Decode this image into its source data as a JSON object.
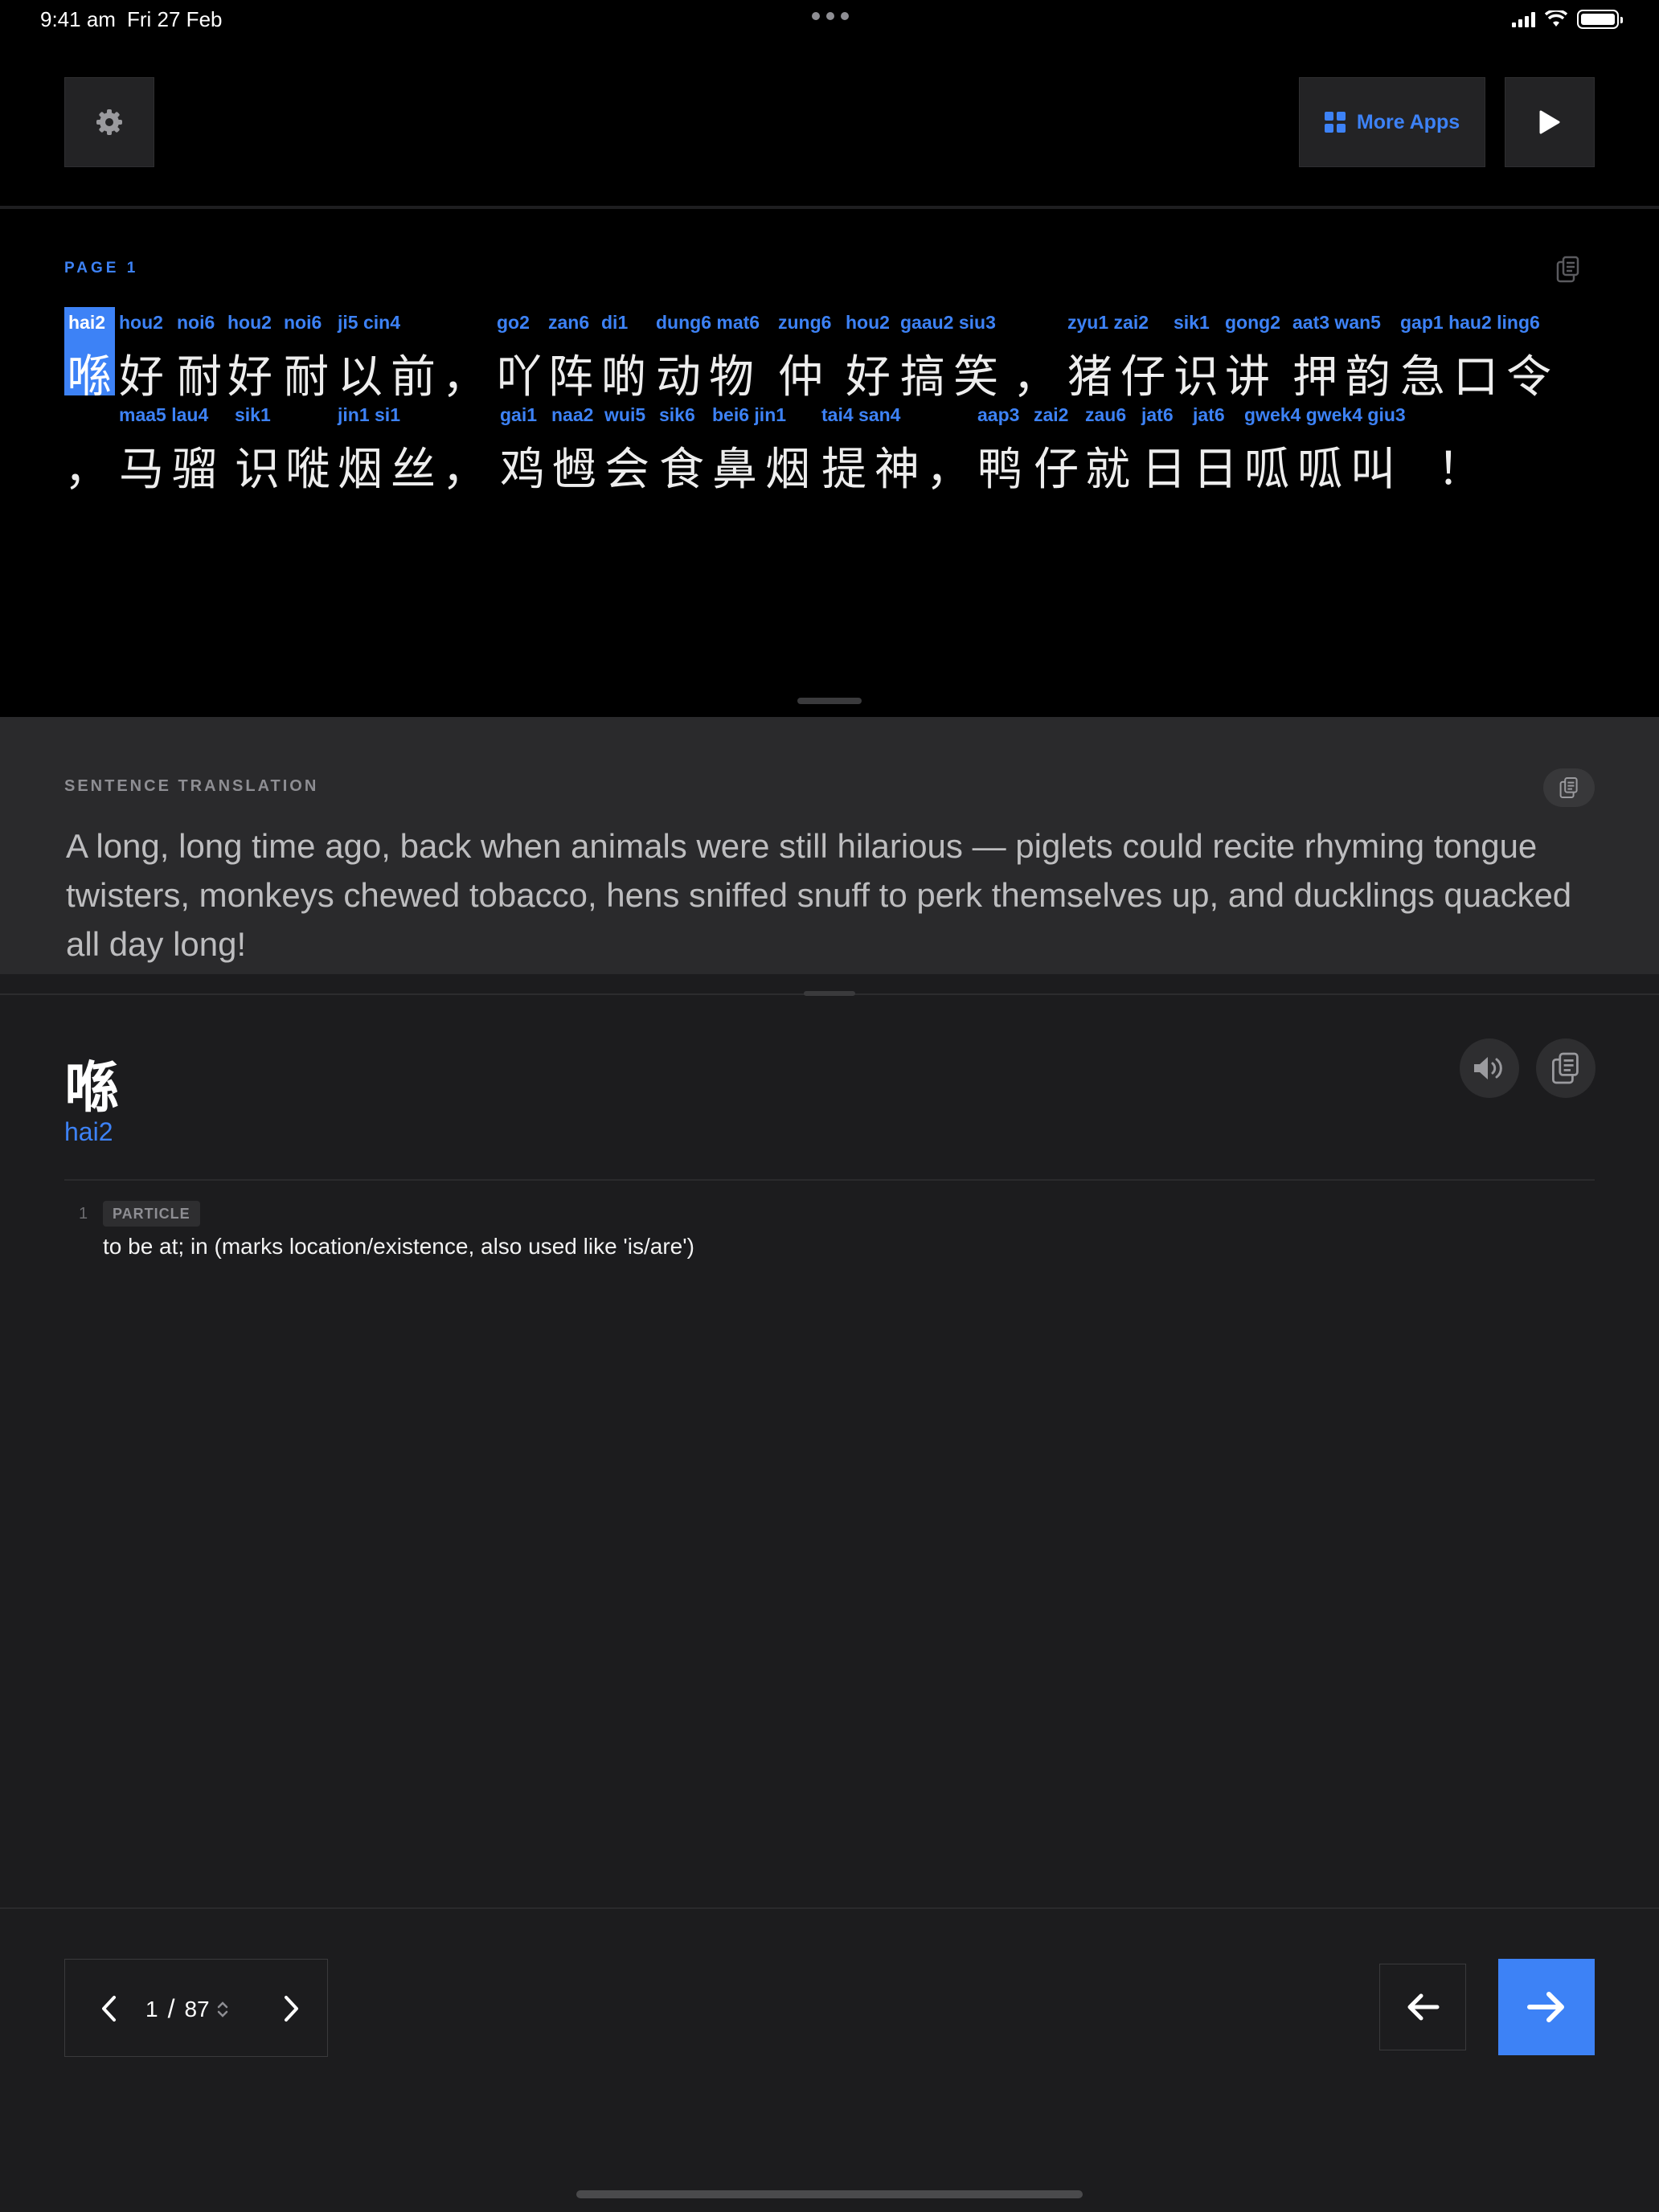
{
  "status_bar": {
    "time": "9:41 am",
    "date": "Fri 27 Feb"
  },
  "toolbar": {
    "more_apps_label": "More Apps"
  },
  "reader": {
    "page_label": "PAGE  1",
    "line1": [
      {
        "ruby": "hai2",
        "hanzi": "喺"
      },
      {
        "ruby": "hou2",
        "hanzi": "好"
      },
      {
        "ruby": "noi6",
        "hanzi": "耐"
      },
      {
        "ruby": "hou2",
        "hanzi": "好"
      },
      {
        "ruby": "noi6",
        "hanzi": "耐"
      },
      {
        "ruby": "ji5 cin4",
        "hanzi": "以前"
      },
      {
        "ruby": "",
        "hanzi": "，"
      },
      {
        "ruby": "go2",
        "hanzi": "吖"
      },
      {
        "ruby": "zan6",
        "hanzi": "阵"
      },
      {
        "ruby": "di1",
        "hanzi": "啲"
      },
      {
        "ruby": "dung6 mat6",
        "hanzi": "动物"
      },
      {
        "ruby": "zung6",
        "hanzi": "仲"
      },
      {
        "ruby": "hou2",
        "hanzi": "好"
      },
      {
        "ruby": "gaau2 siu3",
        "hanzi": "搞笑"
      },
      {
        "ruby": "",
        "hanzi": "，"
      },
      {
        "ruby": "zyu1 zai2",
        "hanzi": "猪仔"
      },
      {
        "ruby": "sik1",
        "hanzi": "识"
      },
      {
        "ruby": "gong2",
        "hanzi": "讲"
      },
      {
        "ruby": "aat3 wan5",
        "hanzi": "押韵"
      },
      {
        "ruby": "gap1 hau2 ling6",
        "hanzi": "急口令"
      }
    ],
    "line2": [
      {
        "ruby": "",
        "hanzi": "，"
      },
      {
        "ruby": "maa5 lau4",
        "hanzi": "马骝"
      },
      {
        "ruby": "sik1",
        "hanzi": "识"
      },
      {
        "ruby": "",
        "hanzi": "嘥"
      },
      {
        "ruby": "jin1 si1",
        "hanzi": "烟丝"
      },
      {
        "ruby": "",
        "hanzi": "，"
      },
      {
        "ruby": "gai1",
        "hanzi": "鸡"
      },
      {
        "ruby": "naa2",
        "hanzi": "乸"
      },
      {
        "ruby": "wui5",
        "hanzi": "会"
      },
      {
        "ruby": "sik6",
        "hanzi": "食"
      },
      {
        "ruby": "bei6 jin1",
        "hanzi": "鼻烟"
      },
      {
        "ruby": "tai4 san4",
        "hanzi": "提神"
      },
      {
        "ruby": "",
        "hanzi": "，"
      },
      {
        "ruby": "aap3",
        "hanzi": "鸭"
      },
      {
        "ruby": "zai2",
        "hanzi": "仔"
      },
      {
        "ruby": "zau6",
        "hanzi": "就"
      },
      {
        "ruby": "jat6",
        "hanzi": "日"
      },
      {
        "ruby": "jat6",
        "hanzi": "日"
      },
      {
        "ruby": "gwek4 gwek4 giu3",
        "hanzi": "呱呱叫"
      },
      {
        "ruby": "",
        "hanzi": "！"
      }
    ]
  },
  "translation": {
    "label": "SENTENCE TRANSLATION",
    "text": "A long, long time ago, back when animals were still hilarious — piglets could recite rhyming tongue twisters, monkeys chewed tobacco, hens sniffed snuff to perk themselves up, and ducklings quacked all day long!"
  },
  "dictionary": {
    "hanzi": "喺",
    "jyutping": "hai2",
    "definitions": [
      {
        "num": "1",
        "pos": "PARTICLE",
        "text": "to be at; in (marks location/existence, also used like 'is/are')"
      }
    ]
  },
  "pager": {
    "current": "1",
    "separator": "/",
    "total": "87"
  },
  "colors": {
    "accent": "#3d82f6",
    "background_top": "#000000",
    "background_panel": "#1c1c1e",
    "background_translation": "#2a2a2c"
  },
  "icons": [
    "gear-icon",
    "grid-icon",
    "play-icon",
    "copy-icon",
    "speaker-icon",
    "chevron-left-icon",
    "chevron-right-icon",
    "stepper-icon",
    "arrow-left-icon",
    "arrow-right-icon"
  ]
}
